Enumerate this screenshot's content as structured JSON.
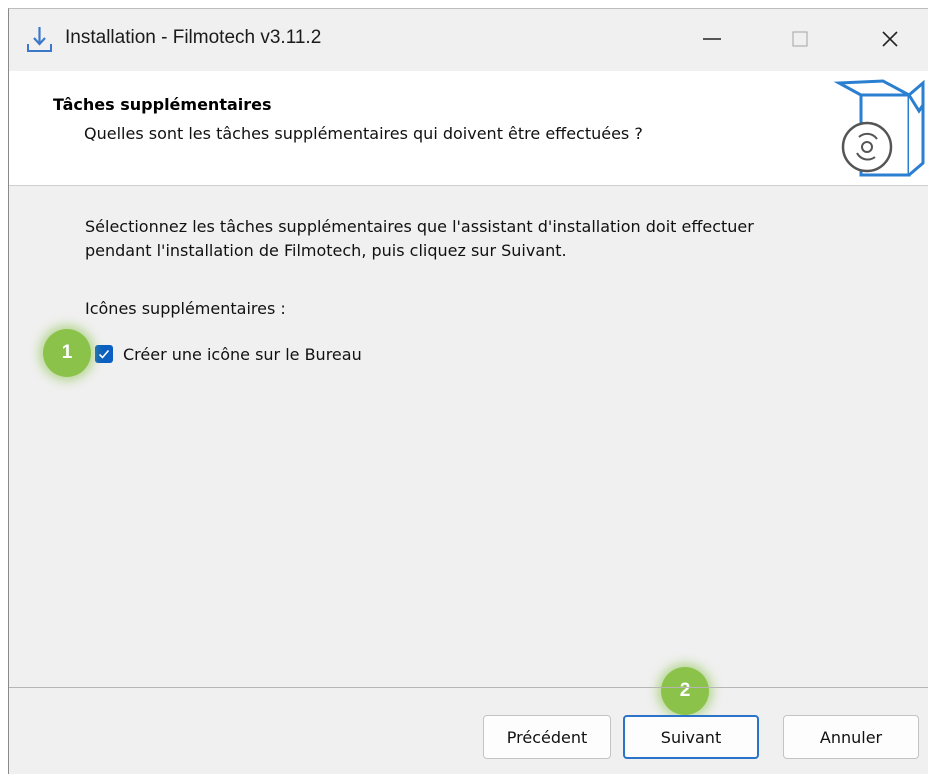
{
  "window": {
    "title": "Installation - Filmotech v3.11.2",
    "controls": {
      "minimize": "—",
      "maximize": "☐",
      "close": "✕"
    }
  },
  "header": {
    "title": "Tâches supplémentaires",
    "subtitle": "Quelles sont les tâches supplémentaires qui doivent être effectuées ?"
  },
  "body": {
    "description_line1": "Sélectionnez les tâches supplémentaires que l'assistant d'installation doit effectuer",
    "description_line2": "pendant l'installation de Filmotech, puis cliquez sur Suivant.",
    "group_label": "Icônes supplémentaires :",
    "tasks": [
      {
        "label": "Créer une icône sur le Bureau",
        "checked": true
      }
    ]
  },
  "annotations": {
    "badge1": "1",
    "badge2": "2",
    "color": "#8bc34a"
  },
  "buttons": {
    "previous": "Précédent",
    "next": "Suivant",
    "cancel": "Annuler"
  },
  "colors": {
    "accent": "#0b5fc2",
    "focus_border": "#2a73c9"
  },
  "icons": {
    "app": "install-download-icon",
    "wizard": "box-disc-icon"
  }
}
